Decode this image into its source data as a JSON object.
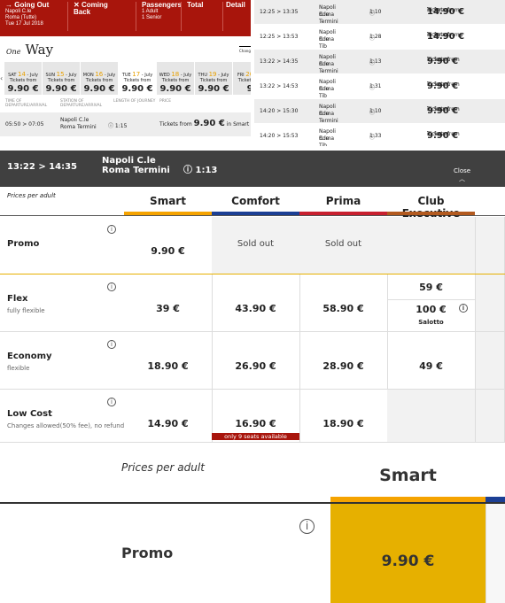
{
  "top_left": {
    "going_out": "Going Out",
    "from": "Napoli C.le",
    "to": "Roma (Tutte)",
    "date": "Tue 17 Jul 2018",
    "coming_back": "Coming Back",
    "passengers_label": "Passengers",
    "passengers": [
      "1 Adult",
      "1 Senior"
    ],
    "total": "Total",
    "detail": "Detail",
    "title_small": "One",
    "title_big": "Way",
    "change": "Chang",
    "days": [
      {
        "wd": "SAT",
        "d": "14",
        "m": "July",
        "from": "Tickets from",
        "price": "9.90 €"
      },
      {
        "wd": "SUN",
        "d": "15",
        "m": "July",
        "from": "Tickets from",
        "price": "9.90 €"
      },
      {
        "wd": "MON",
        "d": "16",
        "m": "July",
        "from": "Tickets from",
        "price": "9.90 €"
      },
      {
        "wd": "TUE",
        "d": "17",
        "m": "July",
        "from": "Tickets from",
        "price": "9.90 €"
      },
      {
        "wd": "WED",
        "d": "18",
        "m": "July",
        "from": "Tickets from",
        "price": "9.90 €"
      },
      {
        "wd": "THU",
        "d": "19",
        "m": "July",
        "from": "Tickets from",
        "price": "9.90 €"
      },
      {
        "wd": "FRI",
        "d": "20",
        "m": "July",
        "from": "Tickets from",
        "price": "9."
      }
    ],
    "col_time": "TIME OF DEPARTURE/ARRIVAL",
    "col_station": "STATION OF DEPARTURE/ARRIVAL",
    "col_length": "LENGTH OF JOURNEY",
    "col_price": "PRICE",
    "row": {
      "time": "05:50 > 07:05",
      "from": "Napoli C.le",
      "to": "Roma Termini",
      "dur": "1:15",
      "pre": "Tickets from",
      "price": "9.90 €",
      "post": "in Smart"
    }
  },
  "top_right": {
    "rows": [
      {
        "time": "12:25 > 13:35",
        "from": "Napoli C.le",
        "to": "Roma Termini",
        "dur": "1:10",
        "pre": "Tickets from",
        "price": "14.90 €",
        "post": "in Smart"
      },
      {
        "time": "12:25 > 13:53",
        "from": "Napoli C.le",
        "to": "Roma Tib",
        "dur": "1:28",
        "pre": "Tickets from",
        "price": "14.90 €",
        "post": "in Smart"
      },
      {
        "time": "13:22 > 14:35",
        "from": "Napoli C.le",
        "to": "Roma Termini",
        "dur": "1:13",
        "pre": "Tickets from",
        "price": "9.90 €",
        "post": "in Smart"
      },
      {
        "time": "13:22 > 14:53",
        "from": "Napoli C.le",
        "to": "Roma Tib",
        "dur": "1:31",
        "pre": "Tickets from",
        "price": "9.90 €",
        "post": "in Smart"
      },
      {
        "time": "14:20 > 15:30",
        "from": "Napoli C.le",
        "to": "Roma Termini",
        "dur": "1:10",
        "pre": "Tickets from",
        "price": "9.90 €",
        "post": "in Smart"
      },
      {
        "time": "14:20 > 15:53",
        "from": "Napoli C.le",
        "to": "Roma Tib",
        "dur": "1:33",
        "pre": "Tickets from",
        "price": "9.90 €",
        "post": "in Smart"
      }
    ]
  },
  "detail": {
    "time": "13:22 > 14:35",
    "from": "Napoli C.le",
    "to": "Roma Termini",
    "dur": "1:13",
    "close": "Close",
    "prices_per_adult": "Prices per adult",
    "classes": [
      {
        "name": "Smart",
        "color": "#f5a300"
      },
      {
        "name": "Comfort",
        "color": "#1c3f94"
      },
      {
        "name": "Prima",
        "color": "#c8202f"
      },
      {
        "name": "Club Executive",
        "color": "#b35a1f"
      }
    ],
    "rows": [
      {
        "name": "Promo",
        "sub": "",
        "cells": [
          "9.90 €",
          "Sold out",
          "Sold out",
          ""
        ]
      },
      {
        "name": "Flex",
        "sub": "fully flexible",
        "cells": [
          "39 €",
          "43.90 €",
          "58.90 €",
          "59 €"
        ],
        "extra": {
          "price": "100 €",
          "label": "Salotto"
        }
      },
      {
        "name": "Economy",
        "sub": "flexible",
        "cells": [
          "18.90 €",
          "26.90 €",
          "28.90 €",
          "49 €"
        ]
      },
      {
        "name": "Low Cost",
        "sub": "Changes allowed(50% fee), no refund",
        "cells": [
          "14.90 €",
          "16.90 €",
          "18.90 €",
          ""
        ],
        "note": "only 9 seats available"
      }
    ]
  },
  "zoomed": {
    "prices_per_adult": "Prices per adult",
    "class": "Smart",
    "row": "Promo",
    "price": "9.90 €",
    "selected_color": "#e6b000"
  }
}
